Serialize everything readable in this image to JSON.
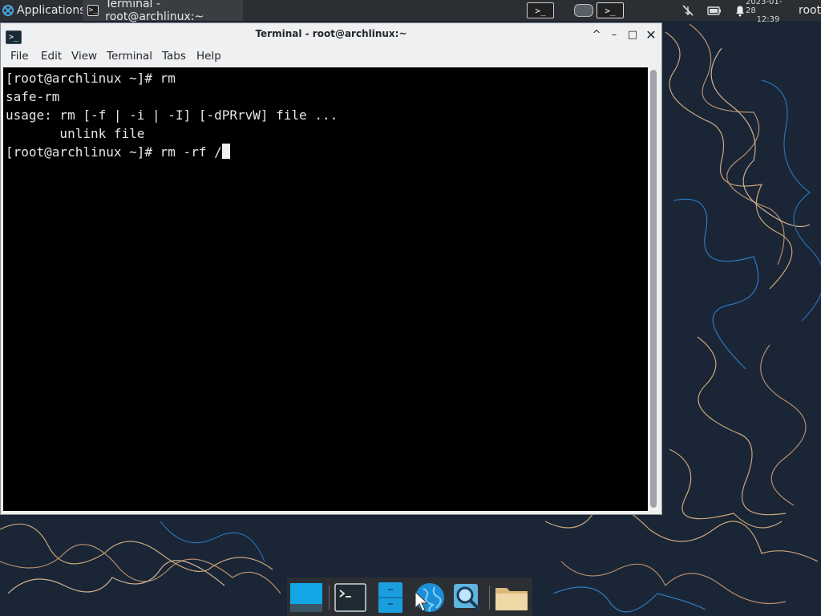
{
  "top_panel": {
    "applications_label": "Applications",
    "taskbar_window_title": "Terminal - root@archlinux:~",
    "terminal_glyph": ">_",
    "clock_date": "2023-01-28",
    "clock_time": "12:39",
    "user": "root"
  },
  "window": {
    "title": "Terminal - root@archlinux:~",
    "buttons": {
      "keep_above": "^",
      "minimize": "–",
      "maximize": "□",
      "close": "✕"
    },
    "menu": [
      "File",
      "Edit",
      "View",
      "Terminal",
      "Tabs",
      "Help"
    ]
  },
  "terminal": {
    "lines": [
      "[root@archlinux ~]# rm",
      "safe-rm",
      "usage: rm [-f | -i | -I] [-dPRrvW] file ...",
      "       unlink file",
      "[root@archlinux ~]# rm -rf /"
    ]
  },
  "dock": {
    "items": [
      "show-desktop",
      "terminal",
      "file-cabinet",
      "web-browser",
      "app-finder",
      "file-manager"
    ]
  },
  "colors": {
    "panel": "#2b2f33",
    "window_chrome": "#eff0f1",
    "terminal_bg": "#000000",
    "terminal_fg": "#e6e6e6",
    "wallpaper": "#1a2536"
  }
}
